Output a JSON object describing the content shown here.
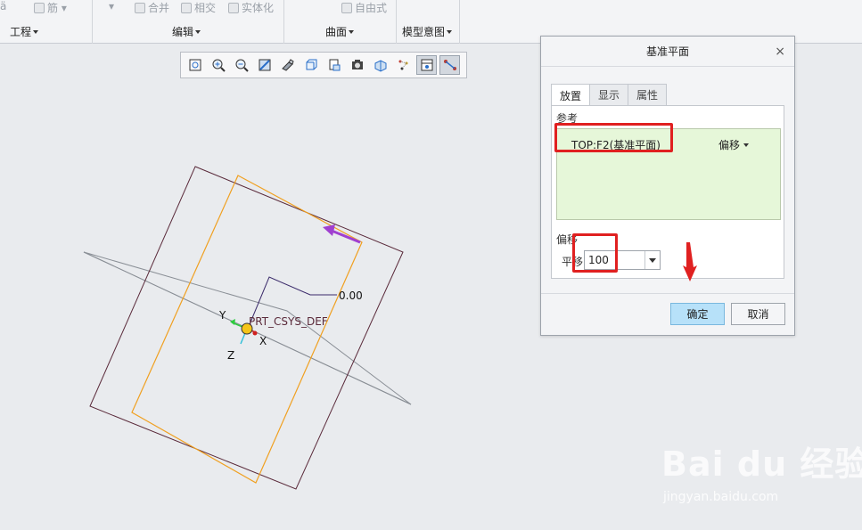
{
  "ribbon": {
    "top_items": [
      {
        "label": "筋",
        "icon": "rib-icon"
      },
      {
        "label": "合并",
        "icon": "merge-icon"
      },
      {
        "label": "相交",
        "icon": "intersect-icon"
      },
      {
        "label": "实体化",
        "icon": "solidify-icon"
      },
      {
        "label": "自由式",
        "icon": "freestyle-icon"
      }
    ],
    "groups": [
      "工程",
      "编辑",
      "曲面",
      "模型意图"
    ]
  },
  "graphics_toolbar": {
    "buttons": [
      "refit-icon",
      "zoom-in-icon",
      "zoom-out-icon",
      "repaint-icon",
      "display-style-icon",
      "saved-orientations-icon",
      "view-manager-icon",
      "perspective-icon",
      "section-icon",
      "datum-display-icon",
      "spin-center-icon",
      "annotation-display-icon"
    ]
  },
  "canvas": {
    "dimension_value": "0.00",
    "csys_label": "PRT_CSYS_DEF",
    "axis_x": "X",
    "axis_y": "Y",
    "axis_z": "Z"
  },
  "dialog": {
    "title": "基准平面",
    "close": "×",
    "tabs": [
      "放置",
      "显示",
      "属性"
    ],
    "active_tab": "放置",
    "references_label": "参考",
    "reference_item": "TOP:F2(基准平面)",
    "constraint_type": "偏移",
    "offset_label": "偏移",
    "translation_label": "平移",
    "translation_value": "100",
    "ok_label": "确定",
    "cancel_label": "取消"
  },
  "watermark": {
    "brand": "Bai du 经验",
    "url": "jingyan.baidu.com"
  },
  "colors": {
    "annotation_red": "#e02020",
    "reference_bg": "#e6f7d9",
    "ok_button": "#b7e1f9",
    "preview_plane": "#f0a020",
    "datum_plane": "#5a2a3a"
  }
}
